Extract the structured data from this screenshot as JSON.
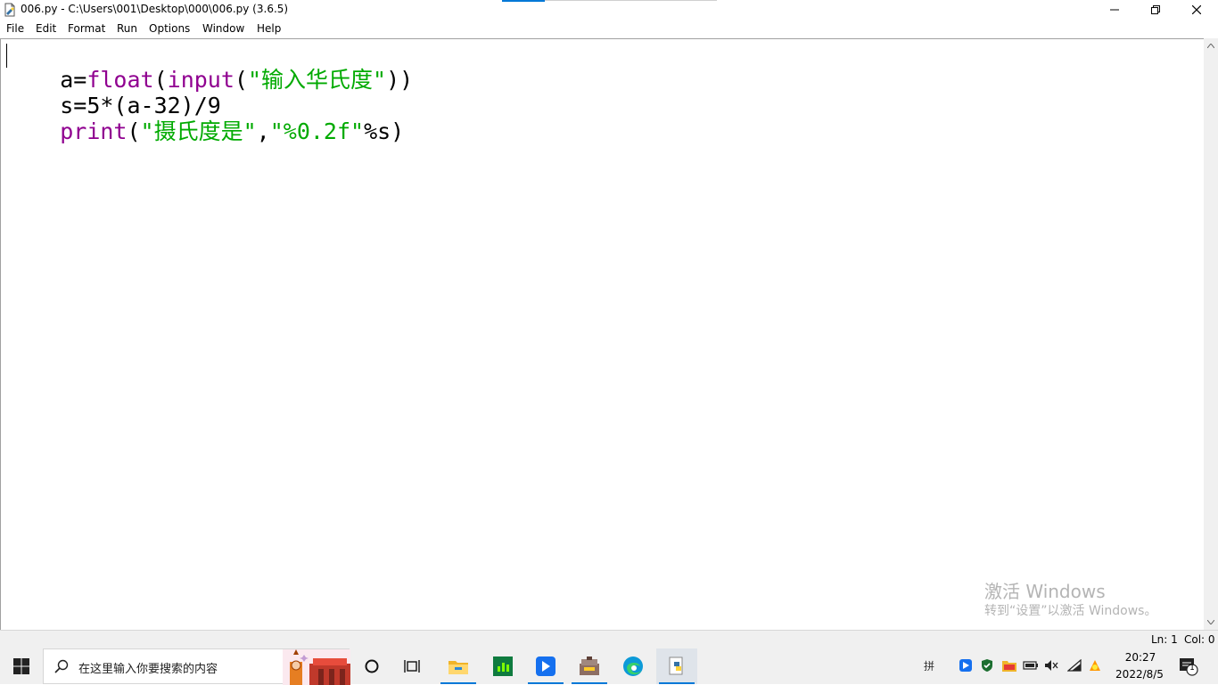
{
  "window": {
    "title": "006.py - C:\\Users\\001\\Desktop\\000\\006.py (3.6.5)"
  },
  "menu": {
    "items": [
      "File",
      "Edit",
      "Format",
      "Run",
      "Options",
      "Window",
      "Help"
    ]
  },
  "editor": {
    "lines": [
      {
        "segments": [
          {
            "text": "a=",
            "kind": "plain"
          },
          {
            "text": "float",
            "kind": "builtin"
          },
          {
            "text": "(",
            "kind": "plain"
          },
          {
            "text": "input",
            "kind": "builtin"
          },
          {
            "text": "(",
            "kind": "plain"
          },
          {
            "text": "\"输入华氏度\"",
            "kind": "string"
          },
          {
            "text": "))",
            "kind": "plain"
          }
        ]
      },
      {
        "segments": [
          {
            "text": "s=5*(a-32)/9",
            "kind": "plain"
          }
        ]
      },
      {
        "segments": [
          {
            "text": "print",
            "kind": "builtin"
          },
          {
            "text": "(",
            "kind": "plain"
          },
          {
            "text": "\"摄氏度是\"",
            "kind": "string"
          },
          {
            "text": ",",
            "kind": "plain"
          },
          {
            "text": "\"%0.2f\"",
            "kind": "string"
          },
          {
            "text": "%s)",
            "kind": "plain"
          }
        ]
      }
    ],
    "colors": {
      "builtin": "#900090",
      "string": "#00aa00",
      "plain": "#000000"
    }
  },
  "watermark": {
    "title": "激活 Windows",
    "subtitle": "转到“设置”以激活 Windows。"
  },
  "status": {
    "ln": "Ln: 1",
    "col": "Col: 0"
  },
  "taskbar": {
    "search_placeholder": "在这里输入你要搜索的内容",
    "apps": [
      "cortana-icon",
      "task-view-icon",
      "file-explorer-icon",
      "green-app-icon",
      "blue-app-icon",
      "toolbox-icon",
      "edge-icon",
      "python-idle-icon"
    ],
    "tray": {
      "ime": "拼",
      "time": "20:27",
      "date": "2022/8/5",
      "notifications": "1"
    }
  },
  "accent_color": "#0078d7"
}
